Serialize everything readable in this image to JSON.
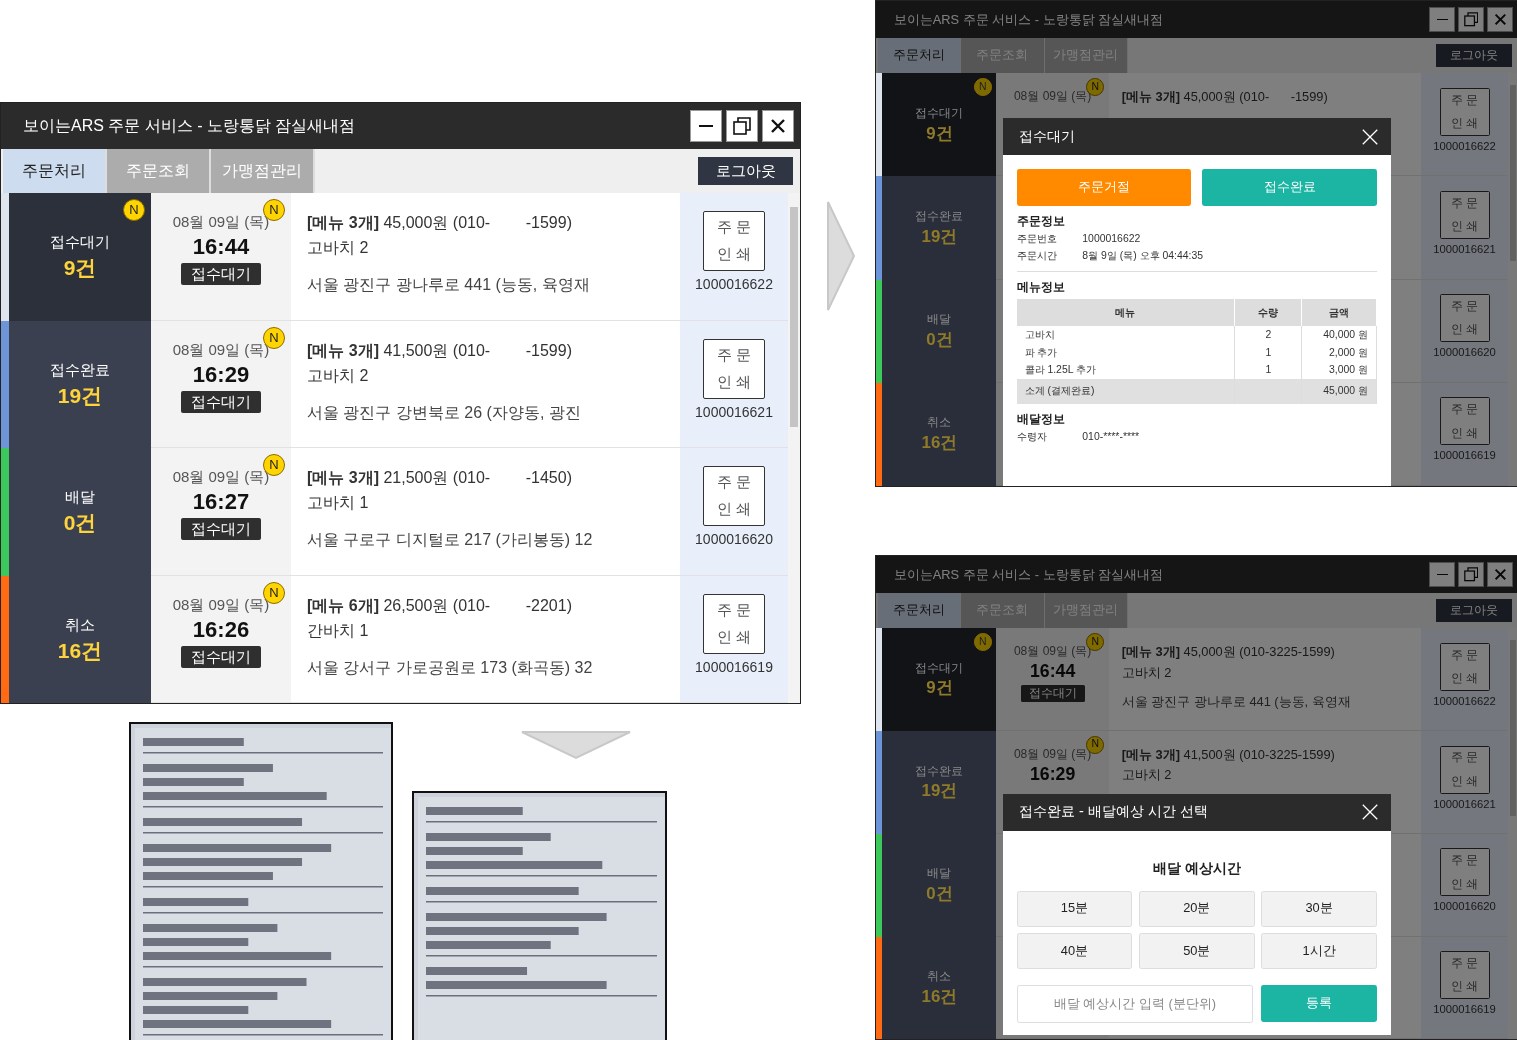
{
  "main_window": {
    "title": "보이는ARS 주문 서비스 - 노랑통닭 잠실새내점",
    "dimmed": false,
    "tabs": [
      {
        "label": "주문처리",
        "selected": true
      },
      {
        "label": "주문조회",
        "selected": false
      },
      {
        "label": "가맹점관리",
        "selected": false
      }
    ],
    "logout": "로그아웃",
    "categories": [
      {
        "label": "접수대기",
        "count": "9건",
        "color": "#dfe5ef",
        "selected": true,
        "badge": "N"
      },
      {
        "label": "접수완료",
        "count": "19건",
        "color": "#6f95d9",
        "selected": false
      },
      {
        "label": "배달",
        "count": "0건",
        "color": "#3cc85a",
        "selected": false
      },
      {
        "label": "취소",
        "count": "16건",
        "color": "#ff6a13",
        "selected": false
      }
    ],
    "orders": [
      {
        "date": "08월 09일 (목)",
        "time": "16:44",
        "status": "접수대기",
        "badge": "N",
        "summary": "**[메뉴 3개]** 45,000원 (010-        -1599)",
        "item": "고바치 2",
        "address": "서울 광진구 광나루로 441 (능동, 육영재",
        "print_label": [
          "주 문",
          "인 쇄"
        ],
        "order_no": "1000016622"
      },
      {
        "date": "08월 09일 (목)",
        "time": "16:29",
        "status": "접수대기",
        "badge": "N",
        "summary": "**[메뉴 3개]** 41,500원 (010-        -1599)",
        "item": "고바치 2",
        "address": "서울 광진구 강변북로 26 (자양동, 광진",
        "print_label": [
          "주 문",
          "인 쇄"
        ],
        "order_no": "1000016621"
      },
      {
        "date": "08월 09일 (목)",
        "time": "16:27",
        "status": "접수대기",
        "badge": "N",
        "summary": "**[메뉴 3개]** 21,500원 (010-        -1450)",
        "item": "고바치 1",
        "address": "서울 구로구 디지털로 217 (가리봉동) 12",
        "print_label": [
          "주 문",
          "인 쇄"
        ],
        "order_no": "1000016620"
      },
      {
        "date": "08월 09일 (목)",
        "time": "16:26",
        "status": "접수대기",
        "badge": "N",
        "summary": "**[메뉴 6개]** 26,500원 (010-        -2201)",
        "item": "간바치 1",
        "address": "서울 강서구 가로공원로 173 (화곡동) 32",
        "print_label": [
          "주 문",
          "인 쇄"
        ],
        "order_no": "1000016619"
      }
    ]
  },
  "dialog_windows": [
    {
      "title": "보이는ARS 주문 서비스 - 노랑통닭 잠실새내점",
      "dimmed": true,
      "tabs": [
        {
          "label": "주문처리",
          "selected": true
        },
        {
          "label": "주문조회",
          "selected": false
        },
        {
          "label": "가맹점관리",
          "selected": false
        }
      ],
      "logout": "로그아웃",
      "categories": [
        {
          "label": "접수대기",
          "count": "9건",
          "color": "#dfe5ef",
          "selected": true,
          "badge": "N"
        },
        {
          "label": "접수완료",
          "count": "19건",
          "color": "#6f95d9",
          "selected": false
        },
        {
          "label": "배달",
          "count": "0건",
          "color": "#3cc85a",
          "selected": false
        },
        {
          "label": "취소",
          "count": "16건",
          "color": "#ff6a13",
          "selected": false
        }
      ],
      "orders": [
        {
          "date": "08월 09일 (목)",
          "badge": "N",
          "summary": "**[메뉴 3개]** 45,000원 (010-      -1599)",
          "print_label": [
            "주 문",
            "인 쇄"
          ],
          "order_no": "1000016622"
        },
        {
          "print_label": [
            "주 문",
            "인 쇄"
          ],
          "order_no": "1000016621"
        },
        {
          "print_label": [
            "주 문",
            "인 쇄"
          ],
          "order_no": "1000016620"
        },
        {
          "print_label": [
            "주 문",
            "인 쇄"
          ],
          "order_no": "1000016619"
        }
      ],
      "dialog": {
        "kind": "order_detail",
        "title": "접수대기",
        "reject": "주문거절",
        "accept": "접수완료",
        "order_section": "주문정보",
        "order_info": [
          {
            "label": "주문번호",
            "value": "1000016622"
          },
          {
            "label": "주문시간",
            "value": "8월 9일 (목) 오후 04:44:35"
          }
        ],
        "menu_section": "메뉴정보",
        "columns": [
          "메뉴",
          "수량",
          "금액"
        ],
        "rows": [
          [
            "고바치",
            "2",
            "40,000 원"
          ],
          [
            "파 추가",
            "1",
            "2,000 원"
          ],
          [
            "콜라 1.25L 추가",
            "1",
            "3,000 원"
          ]
        ],
        "subtotal": [
          "소계 (결제완료)",
          "45,000 원"
        ],
        "delivery_section": "배달정보",
        "delivery_info": [
          {
            "label": "수령자",
            "value": "010-****-****"
          }
        ]
      }
    },
    {
      "title": "보이는ARS 주문 서비스 - 노랑통닭 잠실새내점",
      "dimmed": true,
      "tabs": [
        {
          "label": "주문처리",
          "selected": true
        },
        {
          "label": "주문조회",
          "selected": false
        },
        {
          "label": "가맹점관리",
          "selected": false
        }
      ],
      "logout": "로그아웃",
      "categories": [
        {
          "label": "접수대기",
          "count": "9건",
          "color": "#dfe5ef",
          "selected": true,
          "badge": "N"
        },
        {
          "label": "접수완료",
          "count": "19건",
          "color": "#6f95d9",
          "selected": false
        },
        {
          "label": "배달",
          "count": "0건",
          "color": "#3cc85a",
          "selected": false
        },
        {
          "label": "취소",
          "count": "16건",
          "color": "#ff6a13",
          "selected": false
        }
      ],
      "orders": [
        {
          "date": "08월 09일 (목)",
          "time": "16:44",
          "status": "접수대기",
          "badge": "N",
          "summary": "**[메뉴 3개]** 45,000원 (010-3225-1599)",
          "item": "고바치 2",
          "address": "서울 광진구 광나루로 441 (능동, 육영재",
          "print_label": [
            "주 문",
            "인 쇄"
          ],
          "order_no": "1000016622"
        },
        {
          "date": "08월 09일 (목)",
          "time": "16:29",
          "badge": "N",
          "summary": "**[메뉴 3개]** 41,500원 (010-3225-1599)",
          "item": "고바치 2",
          "print_label": [
            "주 문",
            "인 쇄"
          ],
          "order_no": "1000016621"
        },
        {
          "print_label": [
            "주 문",
            "인 쇄"
          ],
          "order_no": "1000016620"
        },
        {
          "print_label": [
            "주 문",
            "인 쇄"
          ],
          "order_no": "1000016619"
        }
      ],
      "dialog": {
        "kind": "delivery_time",
        "title": "접수완료 - 배달예상 시간 선택",
        "heading": "배달 예상시간",
        "options": [
          "15분",
          "20분",
          "30분",
          "40분",
          "50분",
          "1시간"
        ],
        "placeholder": "배달 예상시간 입력 (분단위)",
        "submit": "등록"
      }
    }
  ]
}
